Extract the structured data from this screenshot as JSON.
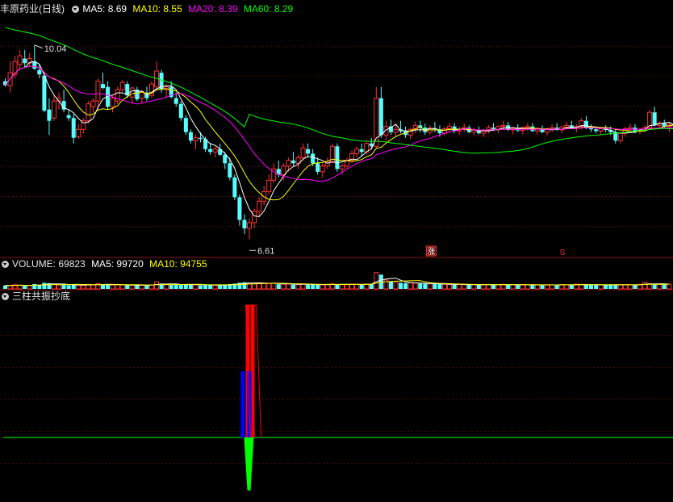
{
  "header_main": {
    "stock_name": "丰原药业",
    "period": "(日线)",
    "ma5": "MA5: 8.69",
    "ma10": "MA10: 8.55",
    "ma20": "MA20: 8.39",
    "ma60": "MA60: 8.29"
  },
  "header_volume": {
    "label": "VOLUME: 69823",
    "ma5": "MA5: 99720",
    "ma10": "MA10: 94755"
  },
  "header_indicator": {
    "label": "三柱共振抄底"
  },
  "annotations": {
    "high_label": "10.04",
    "low_label": "6.61",
    "limit_up_mark": "涨",
    "mark_s": "S"
  },
  "colors": {
    "background": "#000000",
    "up": "#ff3232",
    "down": "#54ffff",
    "ma5": "#ffffff",
    "ma10": "#ffff00",
    "ma20": "#ff00ff",
    "ma60": "#00ff00",
    "panel_border": "#8a1010",
    "grid": "#5a0a0a",
    "text": "#d8d8d8",
    "indicator_red": "#ff0000",
    "indicator_blue": "#0000ff",
    "indicator_green": "#00ff00"
  },
  "chart_data": [
    {
      "type": "candlestick",
      "title": "丰原药业 (日线)",
      "x": [
        0,
        1,
        2,
        3,
        4,
        5,
        6,
        7,
        8,
        9,
        10,
        11,
        12,
        13,
        14,
        15,
        16,
        17,
        18,
        19,
        20,
        21,
        22,
        23,
        24,
        25,
        26,
        27,
        28,
        29,
        30,
        31,
        32,
        33,
        34,
        35,
        36,
        37,
        38,
        39,
        40,
        41,
        42,
        43,
        44,
        45,
        46,
        47,
        48,
        49,
        50,
        51,
        52,
        53,
        54,
        55,
        56,
        57,
        58,
        59,
        60,
        61,
        62,
        63,
        64,
        65,
        66,
        67,
        68,
        69,
        70,
        71,
        72,
        73,
        74,
        75,
        76,
        77,
        78,
        79,
        80,
        81,
        82,
        83,
        84,
        85,
        86,
        87,
        88,
        89,
        90,
        91,
        92,
        93,
        94,
        95,
        96,
        97,
        98,
        99,
        100,
        101,
        102,
        103,
        104,
        105,
        106,
        107,
        108,
        109,
        110,
        111,
        112,
        113,
        114,
        115,
        116,
        117,
        118,
        119,
        120,
        121,
        122,
        123,
        124,
        125,
        126,
        127,
        128,
        129,
        130,
        131,
        132,
        133,
        134,
        135,
        136,
        137
      ],
      "ohlc": [
        [
          9.4,
          9.45,
          9.3,
          9.33
        ],
        [
          9.32,
          9.75,
          9.2,
          9.55
        ],
        [
          9.52,
          9.85,
          9.45,
          9.75
        ],
        [
          9.7,
          9.95,
          9.6,
          9.85
        ],
        [
          9.8,
          9.95,
          9.65,
          9.72
        ],
        [
          9.72,
          9.9,
          9.65,
          9.8
        ],
        [
          9.75,
          10.04,
          9.6,
          9.62
        ],
        [
          9.6,
          9.7,
          9.45,
          9.52
        ],
        [
          9.5,
          9.55,
          8.85,
          8.88
        ],
        [
          8.9,
          9.1,
          8.45,
          8.7
        ],
        [
          8.75,
          9.15,
          8.7,
          9.05
        ],
        [
          9.05,
          9.2,
          8.9,
          9.1
        ],
        [
          9.05,
          9.25,
          8.85,
          8.9
        ],
        [
          8.8,
          8.9,
          8.7,
          8.75
        ],
        [
          8.75,
          8.82,
          8.3,
          8.4
        ],
        [
          8.42,
          8.65,
          8.38,
          8.55
        ],
        [
          8.55,
          8.75,
          8.48,
          8.7
        ],
        [
          8.7,
          9.05,
          8.65,
          9.0
        ],
        [
          8.95,
          9.1,
          8.85,
          9.05
        ],
        [
          9.05,
          9.45,
          8.9,
          9.4
        ],
        [
          9.35,
          9.55,
          9.25,
          9.28
        ],
        [
          9.3,
          9.4,
          8.9,
          8.95
        ],
        [
          8.95,
          9.15,
          8.85,
          9.1
        ],
        [
          9.05,
          9.3,
          9.0,
          9.25
        ],
        [
          9.25,
          9.42,
          9.2,
          9.38
        ],
        [
          9.35,
          9.4,
          9.1,
          9.15
        ],
        [
          9.12,
          9.3,
          9.0,
          9.28
        ],
        [
          9.25,
          9.3,
          9.05,
          9.08
        ],
        [
          9.1,
          9.25,
          9.0,
          9.22
        ],
        [
          9.2,
          9.3,
          9.05,
          9.1
        ],
        [
          9.15,
          9.4,
          9.1,
          9.35
        ],
        [
          9.3,
          9.75,
          9.28,
          9.58
        ],
        [
          9.55,
          9.6,
          9.2,
          9.25
        ],
        [
          9.25,
          9.35,
          9.1,
          9.3
        ],
        [
          9.3,
          9.4,
          9.1,
          9.12
        ],
        [
          9.1,
          9.2,
          8.95,
          9.0
        ],
        [
          9.0,
          9.05,
          8.7,
          8.75
        ],
        [
          8.75,
          8.8,
          8.45,
          8.5
        ],
        [
          8.5,
          8.55,
          8.3,
          8.35
        ],
        [
          8.35,
          8.45,
          8.2,
          8.4
        ],
        [
          8.4,
          8.5,
          8.32,
          8.38
        ],
        [
          8.38,
          8.42,
          8.15,
          8.2
        ],
        [
          8.2,
          8.3,
          8.1,
          8.15
        ],
        [
          8.15,
          8.25,
          8.05,
          8.2
        ],
        [
          8.2,
          8.3,
          8.08,
          8.1
        ],
        [
          8.1,
          8.15,
          7.85,
          7.95
        ],
        [
          7.95,
          8.05,
          7.65,
          7.7
        ],
        [
          7.7,
          7.75,
          7.3,
          7.35
        ],
        [
          7.35,
          7.4,
          6.85,
          6.95
        ],
        [
          6.95,
          7.05,
          6.7,
          6.8
        ],
        [
          6.8,
          6.98,
          6.61,
          6.9
        ],
        [
          6.9,
          7.15,
          6.8,
          7.1
        ],
        [
          7.1,
          7.35,
          7.0,
          7.28
        ],
        [
          7.28,
          7.55,
          7.2,
          7.45
        ],
        [
          7.45,
          7.75,
          7.4,
          7.65
        ],
        [
          7.65,
          7.95,
          7.6,
          7.85
        ],
        [
          7.85,
          8.0,
          7.7,
          7.75
        ],
        [
          7.75,
          7.95,
          7.65,
          7.9
        ],
        [
          7.9,
          8.05,
          7.8,
          8.0
        ],
        [
          8.0,
          8.15,
          7.9,
          7.95
        ],
        [
          7.95,
          8.1,
          7.85,
          8.05
        ],
        [
          8.05,
          8.3,
          8.0,
          8.22
        ],
        [
          8.2,
          8.3,
          8.05,
          8.12
        ],
        [
          8.12,
          8.2,
          7.9,
          7.95
        ],
        [
          7.95,
          8.05,
          7.75,
          7.8
        ],
        [
          7.8,
          7.95,
          7.7,
          7.9
        ],
        [
          7.9,
          8.05,
          7.85,
          7.98
        ],
        [
          7.98,
          8.3,
          7.95,
          8.25
        ],
        [
          8.25,
          8.3,
          7.8,
          7.85
        ],
        [
          7.85,
          7.95,
          7.75,
          7.9
        ],
        [
          7.9,
          8.05,
          7.85,
          8.0
        ],
        [
          8.0,
          8.18,
          7.95,
          8.12
        ],
        [
          8.12,
          8.25,
          8.05,
          8.2
        ],
        [
          8.2,
          8.3,
          8.08,
          8.15
        ],
        [
          8.15,
          8.35,
          8.1,
          8.3
        ],
        [
          8.3,
          8.4,
          8.2,
          8.25
        ],
        [
          8.25,
          9.3,
          8.22,
          9.1
        ],
        [
          9.1,
          9.3,
          8.4,
          8.45
        ],
        [
          8.45,
          8.7,
          8.35,
          8.6
        ],
        [
          8.6,
          8.72,
          8.45,
          8.5
        ],
        [
          8.5,
          8.65,
          8.42,
          8.55
        ],
        [
          8.55,
          8.7,
          8.48,
          8.52
        ],
        [
          8.52,
          8.6,
          8.4,
          8.45
        ],
        [
          8.45,
          8.58,
          8.38,
          8.55
        ],
        [
          8.55,
          8.68,
          8.48,
          8.62
        ],
        [
          8.62,
          8.7,
          8.5,
          8.58
        ],
        [
          8.58,
          8.65,
          8.45,
          8.5
        ],
        [
          8.5,
          8.62,
          8.45,
          8.57
        ],
        [
          8.57,
          8.68,
          8.5,
          8.55
        ],
        [
          8.55,
          8.62,
          8.42,
          8.48
        ],
        [
          8.48,
          8.6,
          8.44,
          8.56
        ],
        [
          8.56,
          8.66,
          8.5,
          8.6
        ],
        [
          8.6,
          8.66,
          8.48,
          8.52
        ],
        [
          8.52,
          8.6,
          8.45,
          8.55
        ],
        [
          8.55,
          8.65,
          8.5,
          8.58
        ],
        [
          8.58,
          8.62,
          8.48,
          8.5
        ],
        [
          8.5,
          8.58,
          8.44,
          8.54
        ],
        [
          8.54,
          8.6,
          8.46,
          8.48
        ],
        [
          8.48,
          8.56,
          8.42,
          8.52
        ],
        [
          8.52,
          8.62,
          8.48,
          8.58
        ],
        [
          8.58,
          8.66,
          8.52,
          8.55
        ],
        [
          8.55,
          8.62,
          8.48,
          8.6
        ],
        [
          8.6,
          8.7,
          8.55,
          8.62
        ],
        [
          8.62,
          8.68,
          8.52,
          8.54
        ],
        [
          8.54,
          8.6,
          8.46,
          8.57
        ],
        [
          8.57,
          8.64,
          8.5,
          8.53
        ],
        [
          8.53,
          8.6,
          8.46,
          8.58
        ],
        [
          8.58,
          8.66,
          8.52,
          8.6
        ],
        [
          8.6,
          8.66,
          8.5,
          8.52
        ],
        [
          8.52,
          8.58,
          8.45,
          8.55
        ],
        [
          8.55,
          8.62,
          8.48,
          8.5
        ],
        [
          8.5,
          8.58,
          8.44,
          8.56
        ],
        [
          8.56,
          8.64,
          8.5,
          8.58
        ],
        [
          8.58,
          8.66,
          8.52,
          8.54
        ],
        [
          8.54,
          8.62,
          8.48,
          8.59
        ],
        [
          8.59,
          8.68,
          8.55,
          8.62
        ],
        [
          8.62,
          8.7,
          8.56,
          8.57
        ],
        [
          8.57,
          8.64,
          8.5,
          8.6
        ],
        [
          8.6,
          8.75,
          8.55,
          8.7
        ],
        [
          8.7,
          8.78,
          8.55,
          8.58
        ],
        [
          8.58,
          8.64,
          8.5,
          8.55
        ],
        [
          8.55,
          8.6,
          8.48,
          8.52
        ],
        [
          8.52,
          8.58,
          8.45,
          8.56
        ],
        [
          8.56,
          8.62,
          8.5,
          8.54
        ],
        [
          8.54,
          8.6,
          8.45,
          8.5
        ],
        [
          8.5,
          8.55,
          8.3,
          8.35
        ],
        [
          8.35,
          8.5,
          8.3,
          8.48
        ],
        [
          8.48,
          8.6,
          8.42,
          8.56
        ],
        [
          8.56,
          8.65,
          8.5,
          8.58
        ],
        [
          8.58,
          8.64,
          8.48,
          8.52
        ],
        [
          8.52,
          8.58,
          8.46,
          8.55
        ],
        [
          8.55,
          8.62,
          8.5,
          8.58
        ],
        [
          8.58,
          8.9,
          8.55,
          8.85
        ],
        [
          8.85,
          8.95,
          8.6,
          8.62
        ],
        [
          8.62,
          8.7,
          8.55,
          8.66
        ],
        [
          8.66,
          8.72,
          8.58,
          8.6
        ],
        [
          8.6,
          8.68,
          8.5,
          8.64
        ],
        [
          8.64,
          8.7,
          8.55,
          8.62
        ]
      ],
      "volume": [
        52000,
        48000,
        61000,
        55000,
        50000,
        47000,
        72000,
        60000,
        90000,
        85000,
        65000,
        58000,
        62000,
        54000,
        70000,
        52000,
        51000,
        66000,
        60000,
        78000,
        64000,
        70000,
        56000,
        60000,
        58000,
        55000,
        54000,
        57000,
        52000,
        53000,
        60000,
        105000,
        80000,
        62000,
        58000,
        60000,
        64000,
        66000,
        70000,
        58000,
        52000,
        56000,
        60000,
        54000,
        57000,
        65000,
        70000,
        78000,
        90000,
        98000,
        88000,
        82000,
        86000,
        80000,
        78000,
        84000,
        70000,
        68000,
        74000,
        64000,
        66000,
        72000,
        62000,
        64000,
        60000,
        62000,
        66000,
        75000,
        70000,
        62000,
        66000,
        70000,
        68000,
        64000,
        72000,
        74000,
        240000,
        210000,
        130000,
        110000,
        96000,
        90000,
        84000,
        88000,
        86000,
        80000,
        76000,
        74000,
        72000,
        70000,
        68000,
        66000,
        64000,
        66000,
        62000,
        60000,
        64000,
        62000,
        60000,
        66000,
        64000,
        62000,
        68000,
        60000,
        62000,
        58000,
        62000,
        60000,
        58000,
        60000,
        56000,
        62000,
        60000,
        58000,
        64000,
        60000,
        62000,
        70000,
        66000,
        60000,
        58000,
        56000,
        60000,
        62000,
        64000,
        60000,
        58000,
        62000,
        60000,
        64000,
        66000,
        98000,
        76000,
        70000,
        68000,
        66000,
        69823
      ],
      "ma5": "MA5: 8.69",
      "ma10": "MA10: 8.55",
      "ma20": "MA20: 8.39",
      "ma60": "MA60: 8.29",
      "ylim": [
        6.3,
        10.55
      ],
      "max_label": "10.04",
      "min_label": "6.61",
      "grid": true
    },
    {
      "type": "bar",
      "title": "三柱共振抄底",
      "x": [
        49,
        50,
        51
      ],
      "series": [
        {
          "name": "red",
          "values": [
            0,
            100,
            100
          ]
        },
        {
          "name": "blue",
          "values": [
            50,
            50,
            0
          ]
        },
        {
          "name": "green",
          "values": [
            0,
            -40,
            0
          ]
        }
      ]
    }
  ]
}
